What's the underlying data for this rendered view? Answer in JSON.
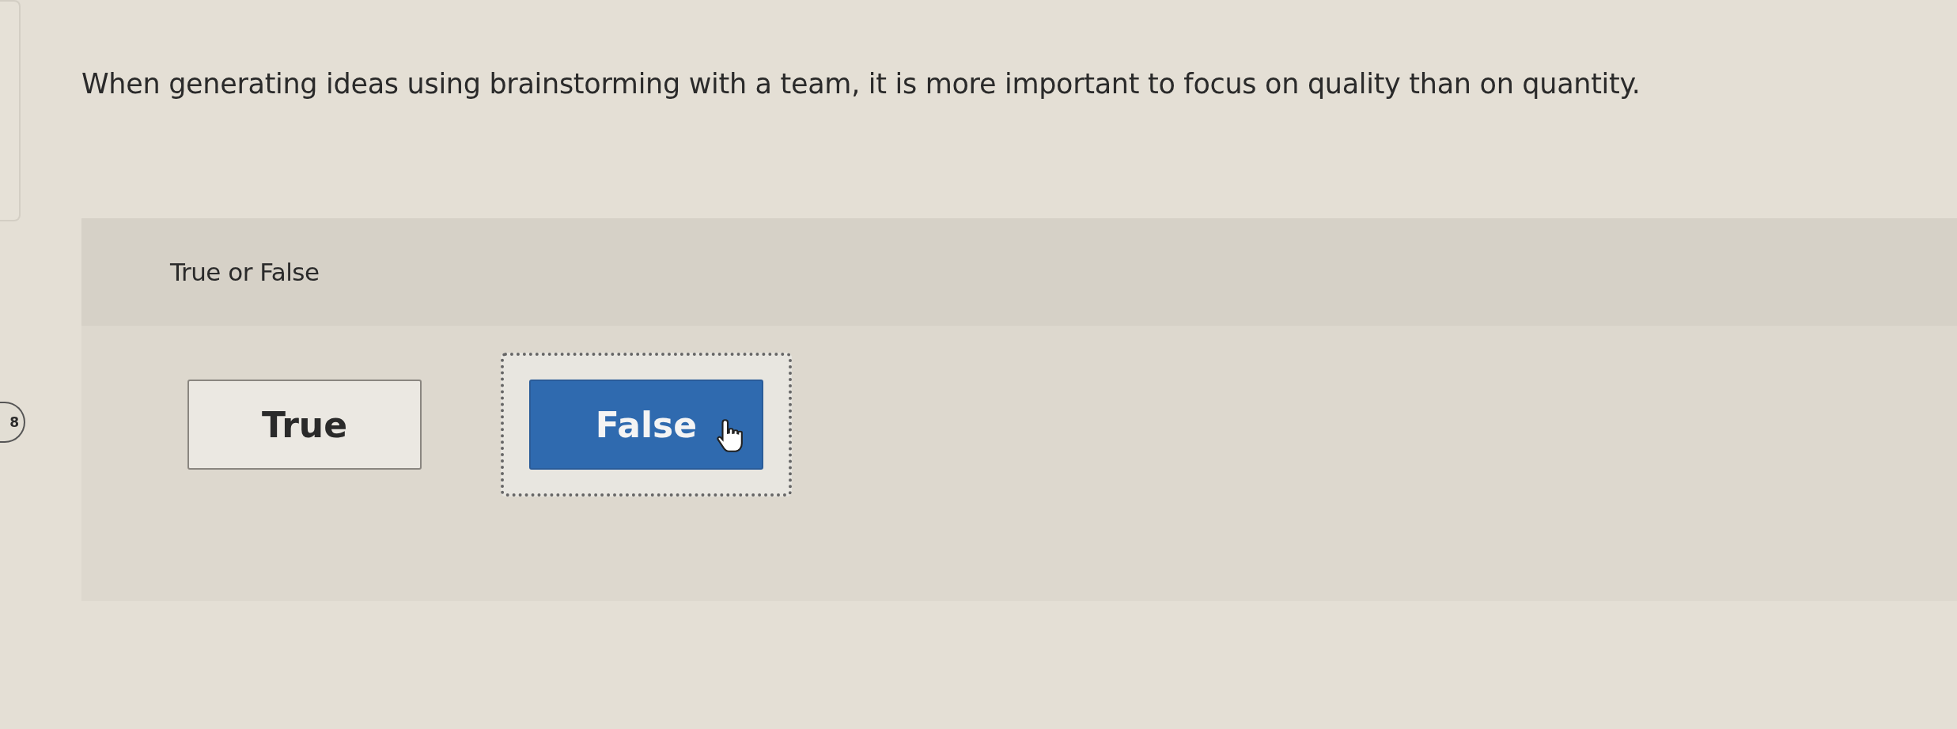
{
  "question": {
    "number": "8",
    "text": "When generating ideas using brainstorming with a team, it is more important to focus on quality than on quantity."
  },
  "answer_panel": {
    "prompt": "True or False",
    "options": [
      {
        "label": "True",
        "selected": false
      },
      {
        "label": "False",
        "selected": true
      }
    ]
  }
}
